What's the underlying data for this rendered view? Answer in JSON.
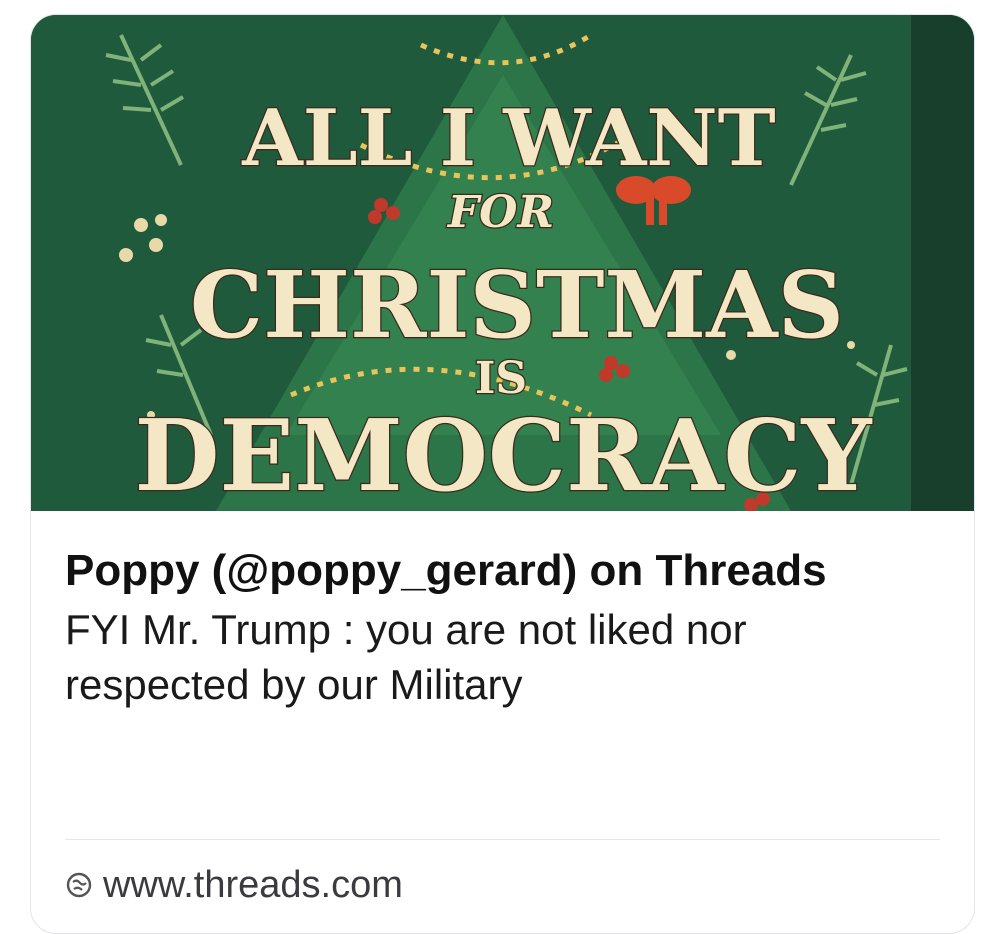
{
  "preview": {
    "image_alt": "Christmas tree sweater graphic",
    "lines": [
      "ALL I WANT",
      "FOR",
      "CHRISTMAS",
      "IS",
      "DEMOCRACY"
    ],
    "colors": {
      "background": "#1f5a3c",
      "tree": "#2f7a4a",
      "lettering": "#f3e7c6",
      "bow": "#d94a2a",
      "garland": "#e8c45a"
    }
  },
  "link": {
    "title": "Poppy (@poppy_gerard) on Threads",
    "description": "FYI Mr. Trump : you are not liked nor respected by our Military",
    "domain": "www.threads.com",
    "domain_icon": "globe-icon"
  }
}
